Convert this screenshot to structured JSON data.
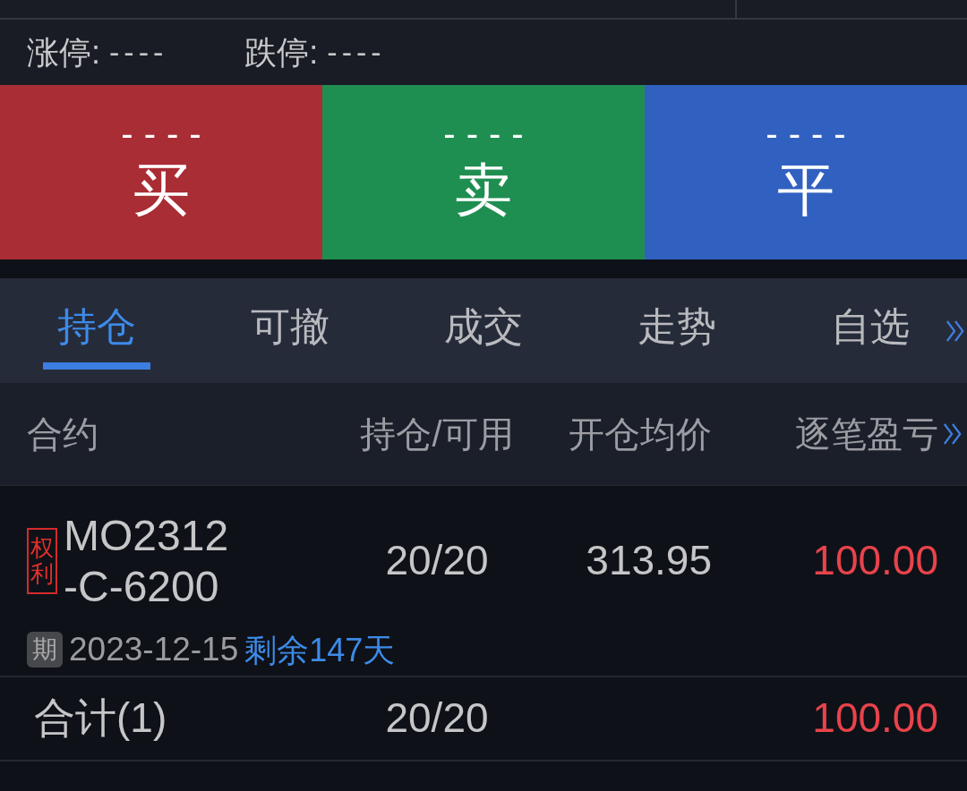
{
  "quote_panel": {
    "price_limits": [
      {
        "label": "涨停:",
        "value": "----"
      },
      {
        "label": "跌停:",
        "value": "----"
      }
    ]
  },
  "order_buttons": [
    {
      "kind": "buy",
      "price": "----",
      "label": "买"
    },
    {
      "kind": "sell",
      "price": "----",
      "label": "卖"
    },
    {
      "kind": "close",
      "price": "----",
      "label": "平"
    }
  ],
  "tabs": [
    {
      "label": "持仓",
      "selected": true
    },
    {
      "label": "可撤",
      "selected": false
    },
    {
      "label": "成交",
      "selected": false
    },
    {
      "label": "走势",
      "selected": false
    },
    {
      "label": "自选",
      "selected": false
    }
  ],
  "table": {
    "columns": [
      "合约",
      "持仓/可用",
      "开仓均价",
      "逐笔盈亏"
    ],
    "rows": [
      {
        "type_tag": "权利",
        "contract": "MO2312-C-6200",
        "position": "20/20",
        "avg_open_price": "313.95",
        "pnl": "100.00",
        "is_profit": true,
        "expiry_tag": "期",
        "expiry_date": "2023-12-15",
        "days_remaining": "剩余147天"
      }
    ],
    "total": {
      "label": "合计(1)",
      "position": "20/20",
      "pnl": "100.00",
      "is_profit": true
    }
  }
}
